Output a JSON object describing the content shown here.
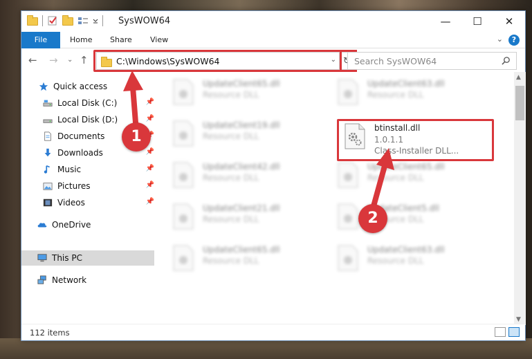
{
  "window": {
    "title": "SysWOW64"
  },
  "ribbon": {
    "tabs": [
      "File",
      "Home",
      "Share",
      "View"
    ],
    "help": "?"
  },
  "address": {
    "path": "C:\\Windows\\SysWOW64",
    "search_placeholder": "Search SysWOW64"
  },
  "navpane": {
    "items": [
      {
        "label": "Quick access",
        "icon": "star-icon",
        "pinned": false
      },
      {
        "label": "Local Disk (C:)",
        "icon": "drive-icon",
        "pinned": true
      },
      {
        "label": "Local Disk (D:)",
        "icon": "drive-icon",
        "pinned": true
      },
      {
        "label": "Documents",
        "icon": "document-icon",
        "pinned": true
      },
      {
        "label": "Downloads",
        "icon": "download-icon",
        "pinned": true
      },
      {
        "label": "Music",
        "icon": "music-icon",
        "pinned": true
      },
      {
        "label": "Pictures",
        "icon": "pictures-icon",
        "pinned": true
      },
      {
        "label": "Videos",
        "icon": "videos-icon",
        "pinned": true
      },
      {
        "label": "OneDrive",
        "icon": "cloud-icon",
        "pinned": false
      },
      {
        "label": "This PC",
        "icon": "pc-icon",
        "pinned": false,
        "selected": true
      },
      {
        "label": "Network",
        "icon": "network-icon",
        "pinned": false
      }
    ]
  },
  "files": {
    "highlighted": {
      "name": "btinstall.dll",
      "version": "1.0.1.1",
      "desc": "Class-Installer DLL..."
    },
    "blurred": [
      {
        "name": "UpdateClient65.dll",
        "desc": "Resource DLL"
      },
      {
        "name": "UpdateClient63.dll",
        "desc": "Resource DLL"
      },
      {
        "name": "UpdateClient19.dll",
        "desc": "Resource DLL"
      },
      {
        "name": "UpdateClient42.dll",
        "desc": "Resource DLL"
      },
      {
        "name": "UpdateClient65.dll",
        "desc": "Resource DLL"
      },
      {
        "name": "UpdateClient21.dll",
        "desc": "Resource DLL"
      },
      {
        "name": "UpdateClient5.dll",
        "desc": "Resource DLL"
      },
      {
        "name": "UpdateClient65.dll",
        "desc": "Resource DLL"
      },
      {
        "name": "UpdateClient63.dll",
        "desc": "Resource DLL"
      }
    ]
  },
  "status": {
    "item_count": "112 items"
  },
  "annotations": {
    "badge1": "1",
    "badge2": "2",
    "color": "#d9373b"
  }
}
